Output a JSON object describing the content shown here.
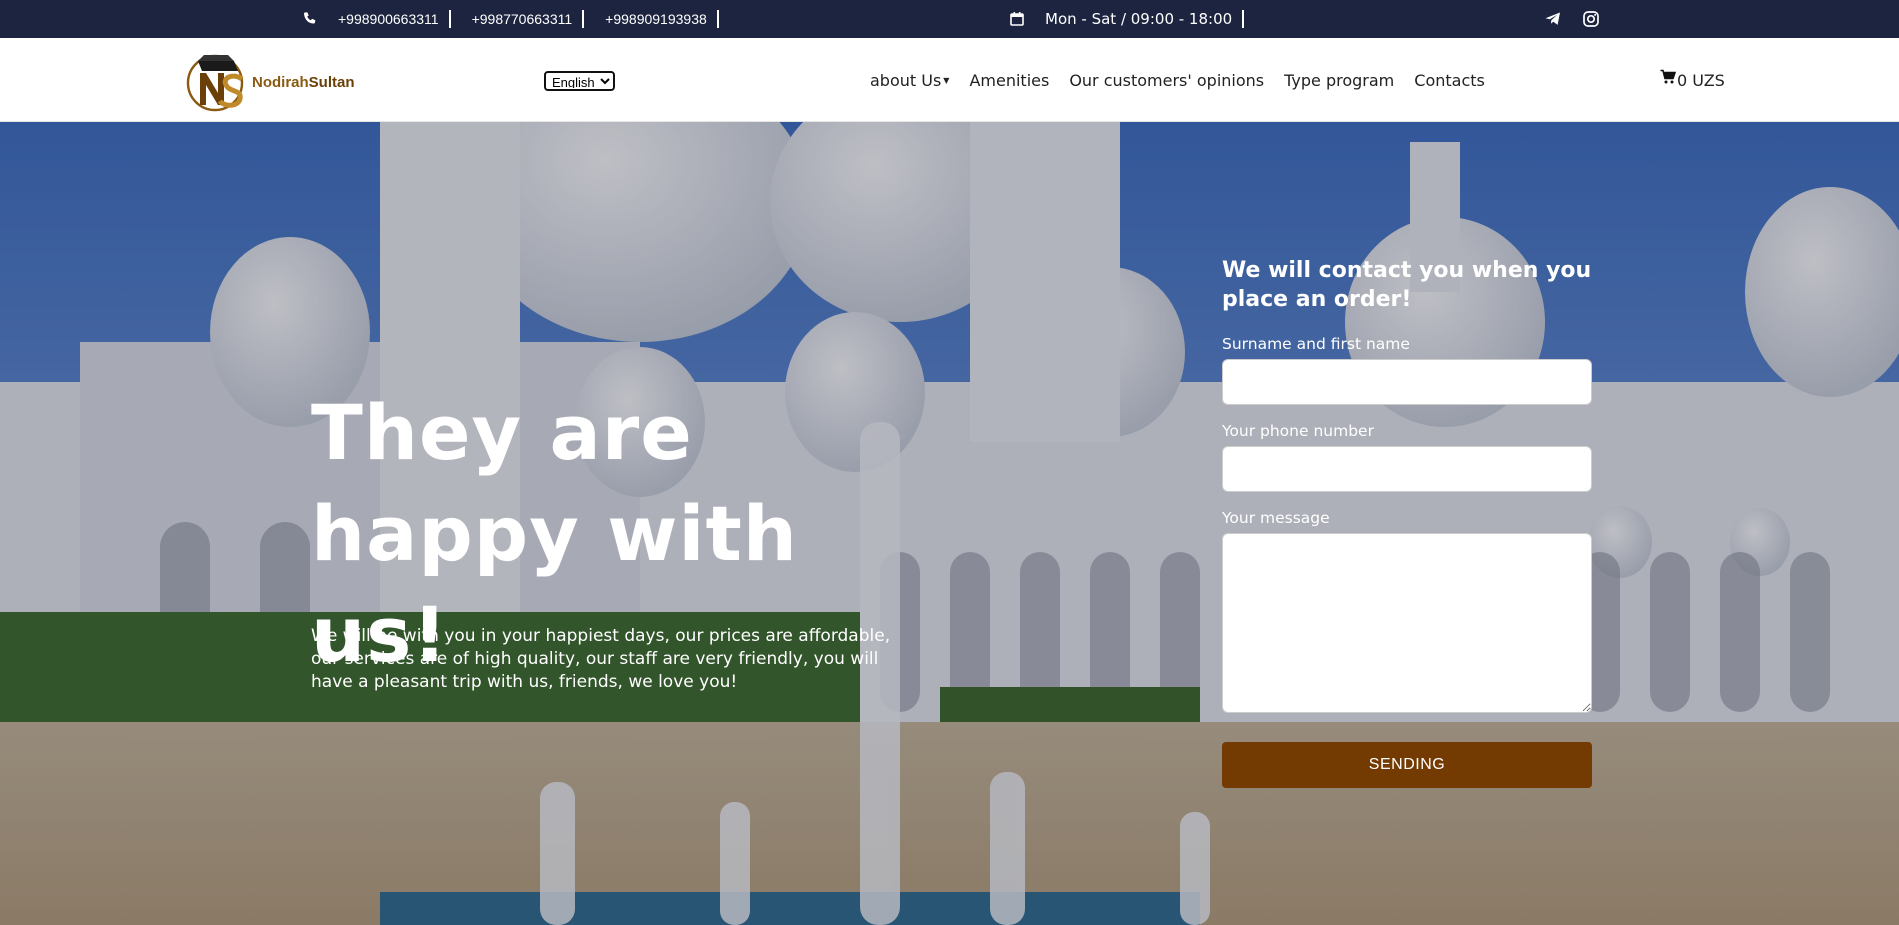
{
  "topbar": {
    "phones": [
      "+998900663311",
      "+998770663311",
      "+998909193938"
    ],
    "hours": "Mon - Sat / 09:00 - 18:00"
  },
  "navbar": {
    "logo": {
      "part1": "Nodirah",
      "part2": "Sultan"
    },
    "language": {
      "selected": "English"
    },
    "links": {
      "about": "about Us",
      "amenities": "Amenities",
      "opinions": "Our customers' opinions",
      "type_program": "Type program",
      "contacts": "Contacts"
    },
    "cart": "0 UZS"
  },
  "hero": {
    "title_line1": "They are",
    "title_line2": "happy with us!",
    "lead": "We will be with you in your happiest days, our prices are affordable, our services are of high quality, our staff are very friendly, you will have a pleasant trip with us, friends, we love you!"
  },
  "form": {
    "title": "We will contact you when you place an order!",
    "name_label": "Surname and first name",
    "name_value": "",
    "phone_label": "Your phone number",
    "phone_value": "",
    "message_label": "Your message",
    "message_value": "",
    "submit_label": "SENDING"
  },
  "colors": {
    "topbar_bg": "#1d2440",
    "submit_bg": "#733a02",
    "logo_brown": "#8a5a12"
  },
  "icons": {
    "phone": "phone-icon",
    "calendar": "calendar-icon",
    "telegram": "telegram-icon",
    "instagram": "instagram-icon",
    "cart": "cart-icon"
  }
}
